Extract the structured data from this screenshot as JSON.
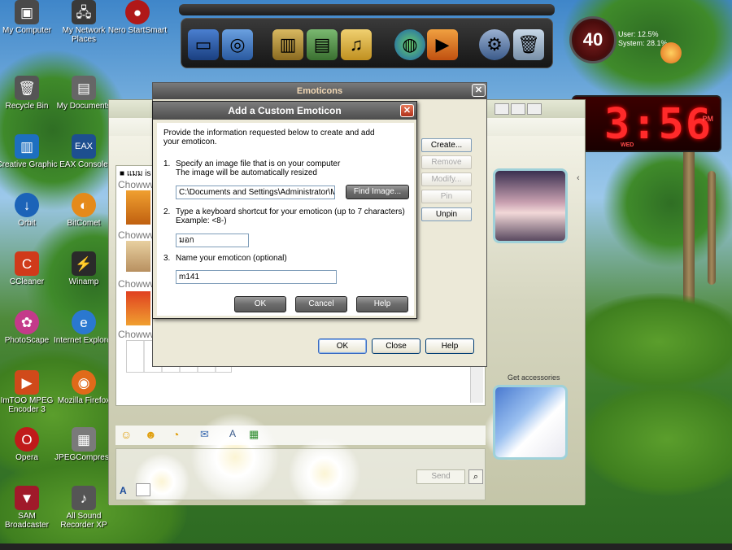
{
  "desktop_icons": [
    {
      "label": "My Computer",
      "icon": "computer-icon",
      "color": "#4a4a4a"
    },
    {
      "label": "My Network Places",
      "icon": "network-places-icon",
      "color": "#3a3a3a"
    },
    {
      "label": "Nero StartSmart",
      "icon": "nero-icon",
      "color": "#b01818"
    },
    {
      "label": "Recycle Bin",
      "icon": "recycle-bin-icon",
      "color": "#555"
    },
    {
      "label": "My Documents",
      "icon": "my-documents-icon",
      "color": "#666"
    },
    {
      "label": "Creative Graphic",
      "icon": "creative-graphic-icon",
      "color": "#1d6fc0"
    },
    {
      "label": "EAX Console",
      "icon": "eax-console-icon",
      "color": "#1d4f8f"
    },
    {
      "label": "Orbit",
      "icon": "orbit-icon",
      "color": "#1c63b8"
    },
    {
      "label": "BitComet",
      "icon": "bitcomet-icon",
      "color": "#e58a1a"
    },
    {
      "label": "CCleaner",
      "icon": "ccleaner-icon",
      "color": "#d03a1a"
    },
    {
      "label": "Winamp",
      "icon": "winamp-icon",
      "color": "#2a2a2a"
    },
    {
      "label": "PhotoScape",
      "icon": "photoscape-icon",
      "color": "#c43a8a"
    },
    {
      "label": "Internet Explorer",
      "icon": "internet-explorer-icon",
      "color": "#2a78d0"
    },
    {
      "label": "ImTOO MPEG Encoder 3",
      "icon": "imtoo-icon",
      "color": "#d04a1a"
    },
    {
      "label": "Mozilla Firefox",
      "icon": "firefox-icon",
      "color": "#e06a1a"
    },
    {
      "label": "Opera",
      "icon": "opera-icon",
      "color": "#c01a1a"
    },
    {
      "label": "JPEGCompress",
      "icon": "jpegcompress-icon",
      "color": "#7a7a7a"
    },
    {
      "label": "SAM Broadcaster",
      "icon": "sam-broadcaster-icon",
      "color": "#a01a2a"
    },
    {
      "label": "All Sound Recorder XP",
      "icon": "sound-recorder-icon",
      "color": "#555"
    }
  ],
  "cpu_gadget": {
    "value": "40",
    "user": "User: 12.5%",
    "system": "System: 28.1%"
  },
  "clock": {
    "time": "3:56",
    "ampm": "PM",
    "day": "WED"
  },
  "messenger": {
    "header_text": "แมม is",
    "chat_name": "Chowww",
    "get_accessories": "Get accessories",
    "send_label": "Send"
  },
  "emoticons_dialog": {
    "title": "Emoticons",
    "buttons": {
      "create": "Create...",
      "remove": "Remove",
      "modify": "Modify...",
      "pin": "Pin",
      "unpin": "Unpin",
      "ok": "OK",
      "close": "Close",
      "help": "Help"
    }
  },
  "custom_emoticon_dialog": {
    "title": "Add a Custom Emoticon",
    "intro": "Provide the information requested below to create and add your emoticon.",
    "step1_num": "1.",
    "step1_line1": "Specify an image file that is on your computer",
    "step1_line2": "The image will be automatically resized",
    "file_path": "C:\\Documents and Settings\\Administrator\\My",
    "find_image": "Find Image...",
    "step2_num": "2.",
    "step2_line1": "Type a keyboard shortcut for your emoticon (up to 7 characters)",
    "step2_line2": "Example: <8-)",
    "shortcut": "มอก",
    "step3_num": "3.",
    "step3_line1": "Name your emoticon (optional)",
    "name": "m141",
    "ok": "OK",
    "cancel": "Cancel",
    "help": "Help"
  }
}
